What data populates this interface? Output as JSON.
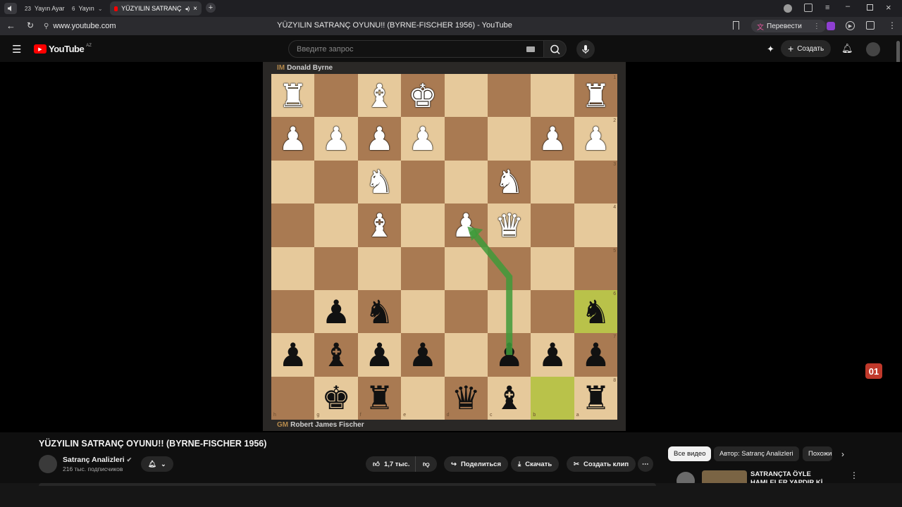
{
  "browser": {
    "tabs": [
      {
        "count": "23",
        "label": "Yayın Ayar"
      },
      {
        "count": "6",
        "label": "Yayın"
      },
      {
        "label": "YÜZYILIN SATRANÇ"
      }
    ],
    "url": "www.youtube.com",
    "page_title": "YÜZYILIN SATRANÇ OYUNU!! (BYRNE-FISCHER 1956) - YouTube",
    "translate_label": "Перевести"
  },
  "youtube": {
    "logo_text": "YouTube",
    "region": "AZ",
    "search_placeholder": "Введите запрос",
    "create_label": "Создать"
  },
  "board": {
    "top_player": {
      "title": "IM",
      "name": "Donald Byrne"
    },
    "bottom_player": {
      "title": "GM",
      "name": "Robert James Fischer"
    },
    "rank_labels": [
      "1",
      "2",
      "3",
      "4",
      "5",
      "6",
      "7",
      "8"
    ],
    "file_labels": [
      "h",
      "g",
      "f",
      "e",
      "d",
      "c",
      "b",
      "a"
    ],
    "pieces": [
      {
        "sq": [
          0,
          0
        ],
        "glyph": "♜",
        "color": "w"
      },
      {
        "sq": [
          0,
          2
        ],
        "glyph": "♝",
        "color": "w"
      },
      {
        "sq": [
          0,
          3
        ],
        "glyph": "♚",
        "color": "w"
      },
      {
        "sq": [
          0,
          7
        ],
        "glyph": "♜",
        "color": "w"
      },
      {
        "sq": [
          1,
          0
        ],
        "glyph": "♟",
        "color": "w"
      },
      {
        "sq": [
          1,
          1
        ],
        "glyph": "♟",
        "color": "w"
      },
      {
        "sq": [
          1,
          2
        ],
        "glyph": "♟",
        "color": "w"
      },
      {
        "sq": [
          1,
          3
        ],
        "glyph": "♟",
        "color": "w"
      },
      {
        "sq": [
          1,
          6
        ],
        "glyph": "♟",
        "color": "w"
      },
      {
        "sq": [
          1,
          7
        ],
        "glyph": "♟",
        "color": "w"
      },
      {
        "sq": [
          2,
          2
        ],
        "glyph": "♞",
        "color": "w"
      },
      {
        "sq": [
          2,
          5
        ],
        "glyph": "♞",
        "color": "w"
      },
      {
        "sq": [
          3,
          2
        ],
        "glyph": "♝",
        "color": "w"
      },
      {
        "sq": [
          3,
          4
        ],
        "glyph": "♟",
        "color": "w"
      },
      {
        "sq": [
          3,
          5
        ],
        "glyph": "♛",
        "color": "w"
      },
      {
        "sq": [
          5,
          1
        ],
        "glyph": "♟",
        "color": "b"
      },
      {
        "sq": [
          5,
          2
        ],
        "glyph": "♞",
        "color": "b"
      },
      {
        "sq": [
          5,
          7
        ],
        "glyph": "♞",
        "color": "b"
      },
      {
        "sq": [
          6,
          0
        ],
        "glyph": "♟",
        "color": "b"
      },
      {
        "sq": [
          6,
          1
        ],
        "glyph": "♝",
        "color": "b"
      },
      {
        "sq": [
          6,
          2
        ],
        "glyph": "♟",
        "color": "b"
      },
      {
        "sq": [
          6,
          3
        ],
        "glyph": "♟",
        "color": "b"
      },
      {
        "sq": [
          6,
          5
        ],
        "glyph": "♟",
        "color": "b"
      },
      {
        "sq": [
          6,
          6
        ],
        "glyph": "♟",
        "color": "b"
      },
      {
        "sq": [
          6,
          7
        ],
        "glyph": "♟",
        "color": "b"
      },
      {
        "sq": [
          7,
          1
        ],
        "glyph": "♚",
        "color": "b"
      },
      {
        "sq": [
          7,
          2
        ],
        "glyph": "♜",
        "color": "b"
      },
      {
        "sq": [
          7,
          4
        ],
        "glyph": "♛",
        "color": "b"
      },
      {
        "sq": [
          7,
          5
        ],
        "glyph": "♝",
        "color": "b"
      },
      {
        "sq": [
          7,
          7
        ],
        "glyph": "♜",
        "color": "b"
      }
    ],
    "highlight_squares": [
      [
        5,
        7
      ],
      [
        7,
        6
      ]
    ],
    "colors": {
      "light": "#e6c99b",
      "dark": "#a97a52",
      "highlight": "#b9c24a",
      "arrow": "#3f9a3a"
    },
    "overlay_badge": "01"
  },
  "video": {
    "title": "YÜZYILIN SATRANÇ OYUNU!! (BYRNE-FISCHER 1956)",
    "channel": "Satranç Analizleri",
    "subscribers": "216 тыс. подписчиков",
    "likes": "1,7 тыс.",
    "share_label": "Поделиться",
    "download_label": "Скачать",
    "clip_label": "Создать клип"
  },
  "sidebar": {
    "chips": [
      "Все видео",
      "Автор: Satranç Analizleri",
      "Похожие"
    ],
    "rec_title": "SATRANÇTA ÖYLE HAMLELER YAPDIR Kİ, DERİNLİĞİ ÇOK"
  }
}
